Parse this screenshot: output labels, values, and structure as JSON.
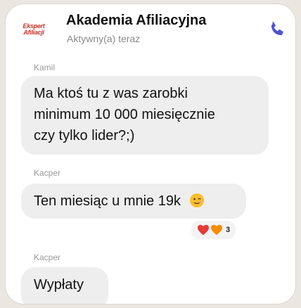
{
  "header": {
    "avatar_line1": "Ekspert",
    "avatar_line2": "Afiliacji",
    "title": "Akademia Afiliacyjna",
    "status": "Aktywny(a) teraz",
    "call_icon": "phone-icon"
  },
  "messages": [
    {
      "sender": "Kamil",
      "text": "Ma ktoś tu z was zarobki\nminimum 10 000 miesięcznie\nczy tylko lider?;)"
    },
    {
      "sender": "Kacper",
      "text": "Ten miesiąc u mnie 19k",
      "emoji": "winking-face"
    },
    {
      "sender": "Kacper",
      "text": "Wypłaty"
    }
  ],
  "reactions": {
    "emojis": [
      "red-heart",
      "orange-heart"
    ],
    "count": "3"
  },
  "colors": {
    "accent": "#4a52d6",
    "bubble": "#eeeeef",
    "brand": "#c8332b"
  }
}
